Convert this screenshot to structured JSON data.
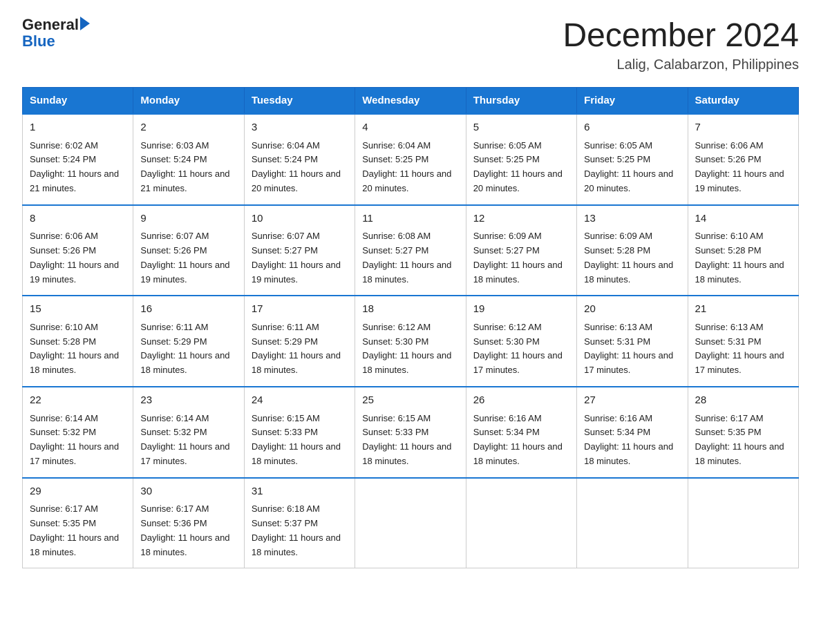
{
  "logo": {
    "text_general": "General",
    "text_blue": "Blue"
  },
  "header": {
    "title": "December 2024",
    "subtitle": "Lalig, Calabarzon, Philippines"
  },
  "days_of_week": [
    "Sunday",
    "Monday",
    "Tuesday",
    "Wednesday",
    "Thursday",
    "Friday",
    "Saturday"
  ],
  "weeks": [
    [
      {
        "day": "1",
        "sunrise": "6:02 AM",
        "sunset": "5:24 PM",
        "daylight": "11 hours and 21 minutes."
      },
      {
        "day": "2",
        "sunrise": "6:03 AM",
        "sunset": "5:24 PM",
        "daylight": "11 hours and 21 minutes."
      },
      {
        "day": "3",
        "sunrise": "6:04 AM",
        "sunset": "5:24 PM",
        "daylight": "11 hours and 20 minutes."
      },
      {
        "day": "4",
        "sunrise": "6:04 AM",
        "sunset": "5:25 PM",
        "daylight": "11 hours and 20 minutes."
      },
      {
        "day": "5",
        "sunrise": "6:05 AM",
        "sunset": "5:25 PM",
        "daylight": "11 hours and 20 minutes."
      },
      {
        "day": "6",
        "sunrise": "6:05 AM",
        "sunset": "5:25 PM",
        "daylight": "11 hours and 20 minutes."
      },
      {
        "day": "7",
        "sunrise": "6:06 AM",
        "sunset": "5:26 PM",
        "daylight": "11 hours and 19 minutes."
      }
    ],
    [
      {
        "day": "8",
        "sunrise": "6:06 AM",
        "sunset": "5:26 PM",
        "daylight": "11 hours and 19 minutes."
      },
      {
        "day": "9",
        "sunrise": "6:07 AM",
        "sunset": "5:26 PM",
        "daylight": "11 hours and 19 minutes."
      },
      {
        "day": "10",
        "sunrise": "6:07 AM",
        "sunset": "5:27 PM",
        "daylight": "11 hours and 19 minutes."
      },
      {
        "day": "11",
        "sunrise": "6:08 AM",
        "sunset": "5:27 PM",
        "daylight": "11 hours and 18 minutes."
      },
      {
        "day": "12",
        "sunrise": "6:09 AM",
        "sunset": "5:27 PM",
        "daylight": "11 hours and 18 minutes."
      },
      {
        "day": "13",
        "sunrise": "6:09 AM",
        "sunset": "5:28 PM",
        "daylight": "11 hours and 18 minutes."
      },
      {
        "day": "14",
        "sunrise": "6:10 AM",
        "sunset": "5:28 PM",
        "daylight": "11 hours and 18 minutes."
      }
    ],
    [
      {
        "day": "15",
        "sunrise": "6:10 AM",
        "sunset": "5:28 PM",
        "daylight": "11 hours and 18 minutes."
      },
      {
        "day": "16",
        "sunrise": "6:11 AM",
        "sunset": "5:29 PM",
        "daylight": "11 hours and 18 minutes."
      },
      {
        "day": "17",
        "sunrise": "6:11 AM",
        "sunset": "5:29 PM",
        "daylight": "11 hours and 18 minutes."
      },
      {
        "day": "18",
        "sunrise": "6:12 AM",
        "sunset": "5:30 PM",
        "daylight": "11 hours and 18 minutes."
      },
      {
        "day": "19",
        "sunrise": "6:12 AM",
        "sunset": "5:30 PM",
        "daylight": "11 hours and 17 minutes."
      },
      {
        "day": "20",
        "sunrise": "6:13 AM",
        "sunset": "5:31 PM",
        "daylight": "11 hours and 17 minutes."
      },
      {
        "day": "21",
        "sunrise": "6:13 AM",
        "sunset": "5:31 PM",
        "daylight": "11 hours and 17 minutes."
      }
    ],
    [
      {
        "day": "22",
        "sunrise": "6:14 AM",
        "sunset": "5:32 PM",
        "daylight": "11 hours and 17 minutes."
      },
      {
        "day": "23",
        "sunrise": "6:14 AM",
        "sunset": "5:32 PM",
        "daylight": "11 hours and 17 minutes."
      },
      {
        "day": "24",
        "sunrise": "6:15 AM",
        "sunset": "5:33 PM",
        "daylight": "11 hours and 18 minutes."
      },
      {
        "day": "25",
        "sunrise": "6:15 AM",
        "sunset": "5:33 PM",
        "daylight": "11 hours and 18 minutes."
      },
      {
        "day": "26",
        "sunrise": "6:16 AM",
        "sunset": "5:34 PM",
        "daylight": "11 hours and 18 minutes."
      },
      {
        "day": "27",
        "sunrise": "6:16 AM",
        "sunset": "5:34 PM",
        "daylight": "11 hours and 18 minutes."
      },
      {
        "day": "28",
        "sunrise": "6:17 AM",
        "sunset": "5:35 PM",
        "daylight": "11 hours and 18 minutes."
      }
    ],
    [
      {
        "day": "29",
        "sunrise": "6:17 AM",
        "sunset": "5:35 PM",
        "daylight": "11 hours and 18 minutes."
      },
      {
        "day": "30",
        "sunrise": "6:17 AM",
        "sunset": "5:36 PM",
        "daylight": "11 hours and 18 minutes."
      },
      {
        "day": "31",
        "sunrise": "6:18 AM",
        "sunset": "5:37 PM",
        "daylight": "11 hours and 18 minutes."
      },
      null,
      null,
      null,
      null
    ]
  ]
}
